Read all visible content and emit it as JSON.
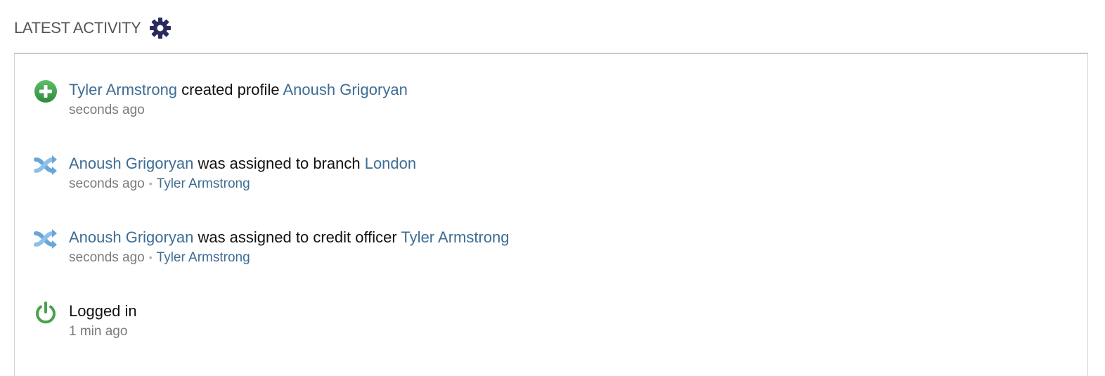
{
  "header": {
    "title": "LATEST ACTIVITY",
    "settings_icon": "gear-icon"
  },
  "colors": {
    "link": "#3d6d94",
    "gear": "#2a2a5e",
    "add_green": "#3f9a4d",
    "power_green": "#4aa24f",
    "assign_blue": "#6aa6d8"
  },
  "activities": [
    {
      "icon": "add-circle-icon",
      "actor": "Tyler Armstrong",
      "action": " created profile ",
      "target": "Anoush Grigoryan",
      "time": "seconds ago"
    },
    {
      "icon": "shuffle-assign-icon",
      "actor": "Anoush Grigoryan",
      "action": " was assigned to branch ",
      "target": "London",
      "time": "seconds ago",
      "by": "Tyler Armstrong"
    },
    {
      "icon": "shuffle-assign-icon",
      "actor": "Anoush Grigoryan",
      "action": " was assigned to credit officer ",
      "target": "Tyler Armstrong",
      "time": "seconds ago",
      "by": "Tyler Armstrong"
    },
    {
      "icon": "power-icon",
      "text": "Logged in",
      "time": "1 min ago"
    }
  ]
}
